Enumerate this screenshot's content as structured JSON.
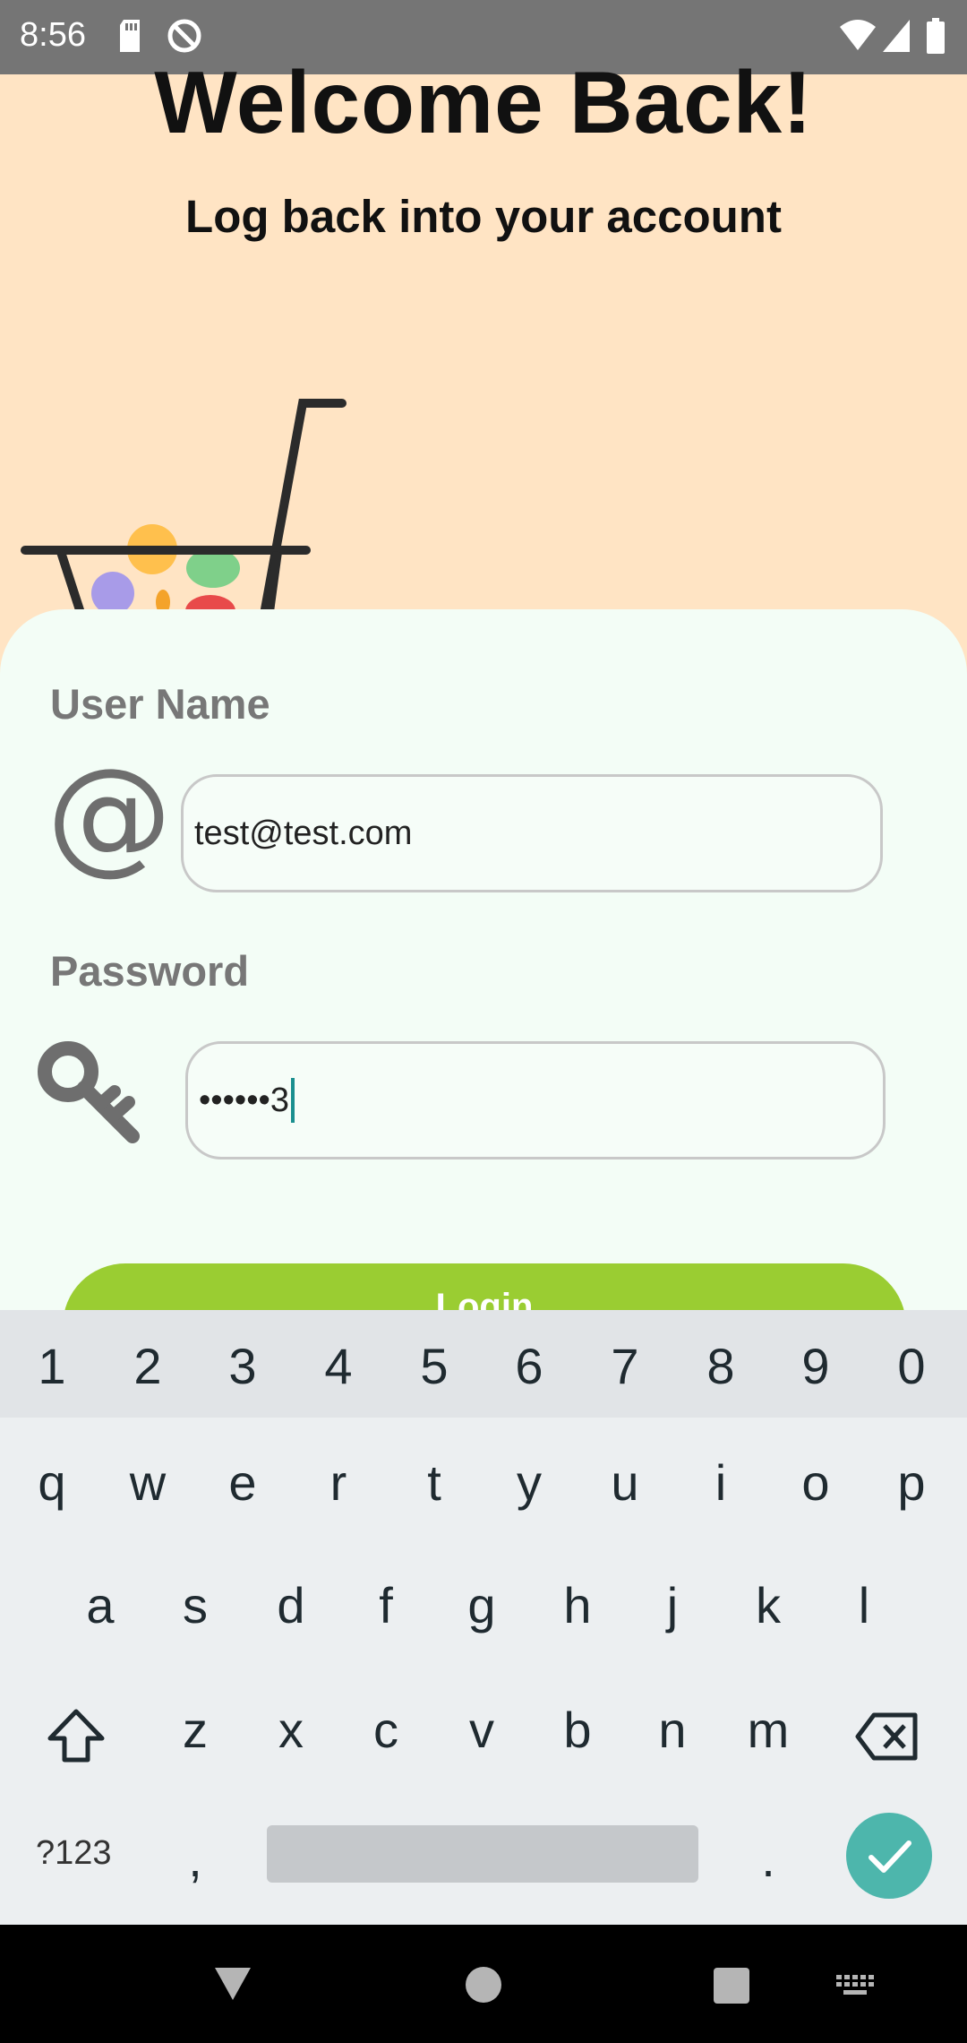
{
  "status_bar": {
    "time": "8:56",
    "icons": [
      "sd-card-icon",
      "no-sync-icon",
      "wifi-icon",
      "signal-icon",
      "battery-icon"
    ]
  },
  "header": {
    "title": "Welcome Back!",
    "subtitle": "Log back into your account"
  },
  "form": {
    "username_label": "User Name",
    "username_value": "test@test.com",
    "password_label": "Password",
    "password_value": "••••••3",
    "login_label": "Login"
  },
  "keyboard": {
    "number_row": [
      "1",
      "2",
      "3",
      "4",
      "5",
      "6",
      "7",
      "8",
      "9",
      "0"
    ],
    "row1": [
      "q",
      "w",
      "e",
      "r",
      "t",
      "y",
      "u",
      "i",
      "o",
      "p"
    ],
    "row2": [
      "a",
      "s",
      "d",
      "f",
      "g",
      "h",
      "j",
      "k",
      "l"
    ],
    "row3": [
      "z",
      "x",
      "c",
      "v",
      "b",
      "n",
      "m"
    ],
    "symbols_label": "?123",
    "comma": ",",
    "period": "."
  },
  "colors": {
    "background": "#ffe4c4",
    "card": "#f3fdf6",
    "login_button": "#9acd32",
    "done_key": "#4db6ac"
  }
}
